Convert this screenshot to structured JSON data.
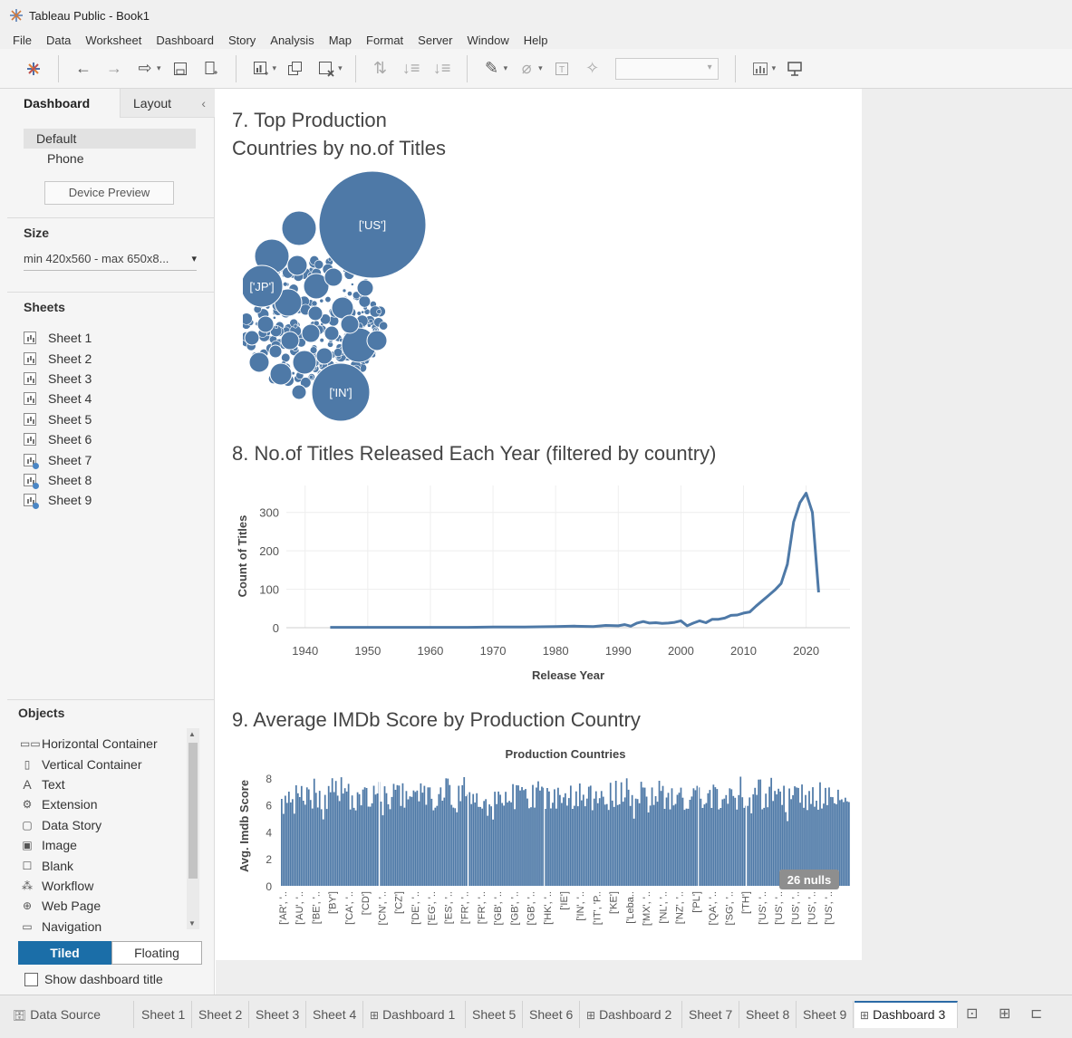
{
  "window": {
    "title": "Tableau Public - Book1"
  },
  "menu": [
    "File",
    "Data",
    "Worksheet",
    "Dashboard",
    "Story",
    "Analysis",
    "Map",
    "Format",
    "Server",
    "Window",
    "Help"
  ],
  "left_pane": {
    "tab_active": "Dashboard",
    "tab_inactive": "Layout",
    "device_default": "Default",
    "device_phone": "Phone",
    "device_preview": "Device Preview",
    "size_title": "Size",
    "size_value": "min 420x560 - max 650x8...",
    "sheets_title": "Sheets",
    "sheets": [
      "Sheet 1",
      "Sheet 2",
      "Sheet 3",
      "Sheet 4",
      "Sheet 5",
      "Sheet 6",
      "Sheet 7",
      "Sheet 8",
      "Sheet 9"
    ],
    "objects_title": "Objects",
    "objects": [
      {
        "label": "Horizontal Container",
        "icon": "horizontal-container-icon"
      },
      {
        "label": "Vertical Container",
        "icon": "vertical-container-icon"
      },
      {
        "label": "Text",
        "icon": "text-icon"
      },
      {
        "label": "Extension",
        "icon": "extension-icon"
      },
      {
        "label": "Data Story",
        "icon": "data-story-icon"
      },
      {
        "label": "Image",
        "icon": "image-icon"
      },
      {
        "label": "Blank",
        "icon": "blank-icon"
      },
      {
        "label": "Workflow",
        "icon": "workflow-icon"
      },
      {
        "label": "Web Page",
        "icon": "web-page-icon"
      },
      {
        "label": "Navigation",
        "icon": "navigation-icon"
      }
    ],
    "tiled": "Tiled",
    "floating": "Floating",
    "show_title": "Show dashboard title"
  },
  "dashboard": {
    "title7_line1": "7. Top Production",
    "title7_line2": "Countries by no.of Titles",
    "title8": "8. No.of Titles Released Each Year (filtered by country)",
    "title9": "9. Average IMDb Score by Production Country"
  },
  "chart_data": [
    {
      "type": "scatter",
      "chart": "packed-bubble",
      "labels": [
        "['US']",
        "['JP']",
        "['IN']"
      ],
      "color": "#4e79a7"
    },
    {
      "type": "line",
      "xlabel": "Release Year",
      "ylabel": "Count of Titles",
      "xticks": [
        1940,
        1950,
        1960,
        1970,
        1980,
        1990,
        2000,
        2010,
        2020
      ],
      "yticks": [
        0,
        100,
        200,
        300
      ],
      "xlim": [
        1937,
        2027
      ],
      "ylim": [
        0,
        370
      ],
      "x": [
        1944,
        1950,
        1956,
        1960,
        1966,
        1970,
        1975,
        1980,
        1983,
        1986,
        1988,
        1990,
        1991,
        1992,
        1993,
        1994,
        1995,
        1996,
        1997,
        1998,
        1999,
        2000,
        2001,
        2002,
        2003,
        2004,
        2005,
        2006,
        2007,
        2008,
        2009,
        2010,
        2011,
        2012,
        2013,
        2014,
        2015,
        2016,
        2017,
        2018,
        2019,
        2020,
        2021,
        2022
      ],
      "y": [
        1,
        1,
        1,
        1,
        1,
        2,
        2,
        3,
        4,
        3,
        6,
        5,
        8,
        4,
        12,
        16,
        12,
        13,
        11,
        12,
        14,
        18,
        5,
        12,
        18,
        13,
        22,
        22,
        25,
        32,
        33,
        38,
        41,
        56,
        70,
        84,
        98,
        115,
        165,
        275,
        325,
        350,
        300,
        92
      ],
      "color": "#4e79a7"
    },
    {
      "type": "bar",
      "title": "Production Countries",
      "xlabel": "",
      "ylabel": "Avg. Imdb Score",
      "yticks": [
        0,
        2,
        4,
        6,
        8
      ],
      "ylim": [
        0,
        8.6
      ],
      "category_labels": [
        "['AR', '..",
        "['AU', '..",
        "['BE', '..",
        "['BY']",
        "['CA', '..",
        "['CD']",
        "['CN', '..",
        "['CZ']",
        "['DE', '..",
        "['EG', '..",
        "['ES', '..",
        "['FR', '..",
        "['FR', '..",
        "['GB', '..",
        "['GB', '..",
        "['GB', '..",
        "['HK', '..",
        "['IE']",
        "['IN', '..",
        "['IT', 'P..",
        "['KE']",
        "['Leba..",
        "['MX', '..",
        "['NL', '..",
        "['NZ', '..",
        "['PL']",
        "['QA', '..",
        "['SG', '..",
        "['TH']",
        "['US', '..",
        "['US', '..",
        "['US', '..",
        "['US', '..",
        "['US', '.."
      ],
      "null_badge": "26 nulls",
      "color": "#4e79a7"
    }
  ],
  "bottom_tabs": [
    {
      "label": "Data Source",
      "icon": "database-icon"
    },
    {
      "label": "Sheet 1"
    },
    {
      "label": "Sheet 2"
    },
    {
      "label": "Sheet 3"
    },
    {
      "label": "Sheet 4"
    },
    {
      "label": "Dashboard 1",
      "icon": "dashboard-icon"
    },
    {
      "label": "Sheet 5"
    },
    {
      "label": "Sheet 6"
    },
    {
      "label": "Dashboard 2",
      "icon": "dashboard-icon"
    },
    {
      "label": "Sheet 7"
    },
    {
      "label": "Sheet 8"
    },
    {
      "label": "Sheet 9"
    },
    {
      "label": "Dashboard 3",
      "icon": "dashboard-icon",
      "active": true
    }
  ]
}
